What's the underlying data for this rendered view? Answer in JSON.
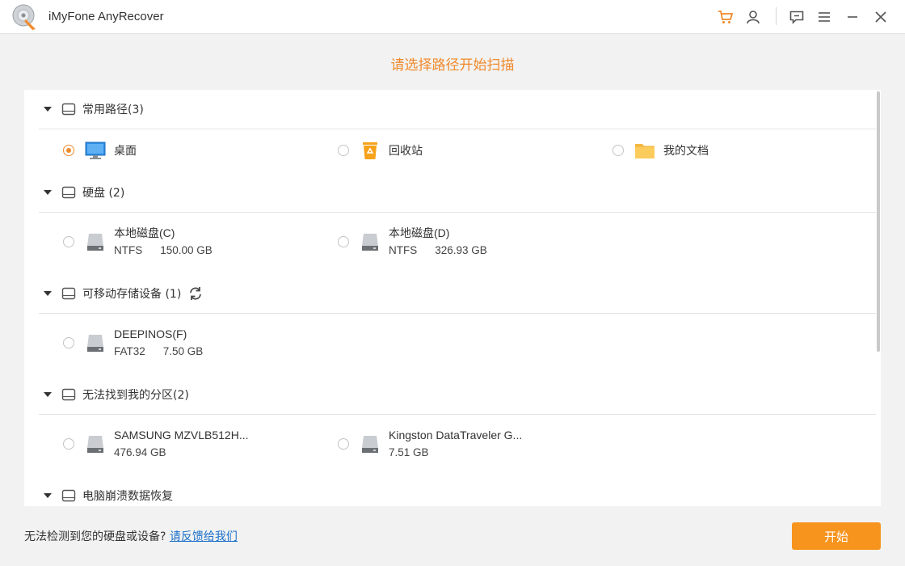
{
  "app": {
    "title": "iMyFone AnyRecover"
  },
  "titlebar": {
    "icons": [
      "cart-icon",
      "user-icon",
      "feedback-icon",
      "menu-icon",
      "minimize-icon",
      "close-icon"
    ],
    "accent": "#f08a2c"
  },
  "heading": "请选择路径开始扫描",
  "sections": {
    "common": {
      "label": "常用路径(3)"
    },
    "disks": {
      "label": "硬盘 (2)"
    },
    "removable": {
      "label": "可移动存储设备 (1)"
    },
    "lost": {
      "label": "无法找到我的分区(2)"
    },
    "crash": {
      "label": "电脑崩溃数据恢复"
    }
  },
  "common_items": [
    {
      "label": "桌面",
      "icon": "desktop-icon",
      "selected": true
    },
    {
      "label": "回收站",
      "icon": "recycle-bin-icon",
      "selected": false
    },
    {
      "label": "我的文档",
      "icon": "folder-icon",
      "selected": false
    }
  ],
  "disks": [
    {
      "name": "本地磁盘(C)",
      "fs": "NTFS",
      "size": "150.00 GB"
    },
    {
      "name": "本地磁盘(D)",
      "fs": "NTFS",
      "size": "326.93 GB"
    }
  ],
  "removable": [
    {
      "name": "DEEPINOS(F)",
      "fs": "FAT32",
      "size": "7.50 GB"
    }
  ],
  "lost": [
    {
      "name": "SAMSUNG MZVLB512H...",
      "size": "476.94 GB"
    },
    {
      "name": "Kingston DataTraveler G...",
      "size": "7.51 GB"
    }
  ],
  "footer": {
    "text": "无法检测到您的硬盘或设备? ",
    "link": "请反馈给我们",
    "start": "开始"
  },
  "colors": {
    "accent": "#f08a2c",
    "button": "#f7941d",
    "link": "#1a6fc9"
  }
}
